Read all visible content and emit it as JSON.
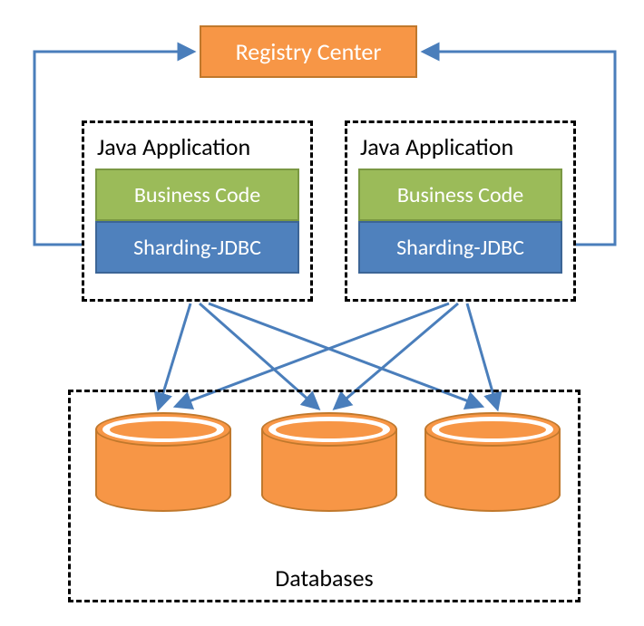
{
  "registry_center": "Registry Center",
  "app_left": {
    "title": "Java Application",
    "business": "Business Code",
    "sharding": "Sharding-JDBC"
  },
  "app_right": {
    "title": "Java Application",
    "business": "Business Code",
    "sharding": "Sharding-JDBC"
  },
  "databases_label": "Databases",
  "colors": {
    "orange": "#f79646",
    "green": "#9bbb59",
    "blue": "#4f81bd",
    "arrow": "#4a7ebb"
  }
}
